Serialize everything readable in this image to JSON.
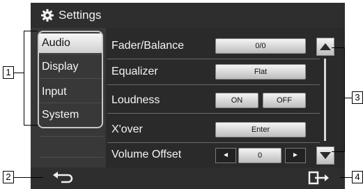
{
  "header": {
    "title": "Settings",
    "icon": "gear-icon"
  },
  "sidebar": {
    "items": [
      {
        "label": "Audio",
        "active": true
      },
      {
        "label": "Display",
        "active": false
      },
      {
        "label": "Input",
        "active": false
      },
      {
        "label": "System",
        "active": false
      }
    ]
  },
  "settings": {
    "rows": [
      {
        "label": "Fader/Balance",
        "value": "0/0"
      },
      {
        "label": "Equalizer",
        "value": "Flat"
      },
      {
        "label": "Loudness",
        "on": "ON",
        "off": "OFF"
      },
      {
        "label": "X'over",
        "value": "Enter"
      },
      {
        "label": "Volume Offset",
        "value": "0"
      }
    ]
  },
  "callouts": [
    "1",
    "2",
    "3",
    "4"
  ],
  "colors": {
    "background": "#2a2a2a",
    "button": "#e0e0e0",
    "text": "#f5f5f5"
  }
}
